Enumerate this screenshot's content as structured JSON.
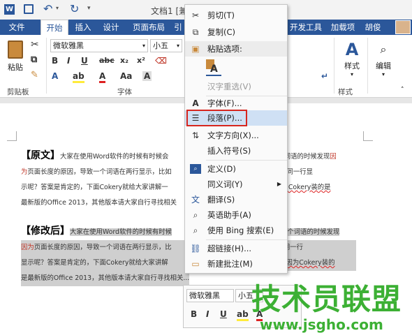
{
  "titlebar": {
    "title": "文档1 [兼容"
  },
  "tabs": [
    "文件",
    "开始",
    "插入",
    "设计",
    "页面布局",
    "引",
    "开发工具",
    "加载项",
    "胡俊"
  ],
  "ribbon": {
    "font_name": "微软雅黑",
    "font_size": "小五",
    "paste_label": "粘贴",
    "style_label": "样式",
    "edit_label": "编辑",
    "group_clipboard": "剪贴板",
    "group_font": "字体",
    "group_style": "样式"
  },
  "document": {
    "original_heading": "【原文】",
    "original_lines": [
      "大家在使用Word软件的时候有时候会",
      "个词语的时候发现",
      "因",
      "为",
      "页面长度的原因，导致一个词语在两行显示，比如",
      "法让词语在同一行显",
      "示呢？答案是肯定的，下面Cokery就给大家讲解一",
      "。因为Cokery装的是",
      "最新版的Office 2013，其他版本请大家自行寻找相关"
    ],
    "revised_heading": "【修改后】",
    "revised_lines": [
      "大家在使用Word软件的时候有时候",
      "一个词语的时候发现",
      "因为",
      "页面长度的原因，导致一个词语在两行显示，比",
      "办法让词语在同一行",
      "显示呢？答案是肯定的，下面Cokery就给大家讲解",
      "吧！因为Cokery装的",
      "是最新版的Office 2013，其他版本请大家自行寻找相关..."
    ]
  },
  "context_menu": {
    "items": [
      {
        "label": "剪切(T)",
        "icon": "scissors-icon",
        "disabled": false
      },
      {
        "label": "复制(C)",
        "icon": "copy-icon",
        "disabled": false
      },
      {
        "label": "粘贴选项:",
        "icon": "paste-icon",
        "disabled": false
      },
      {
        "label": "汉字重选(V)",
        "icon": "",
        "disabled": true
      },
      {
        "label": "字体(F)...",
        "icon": "font-icon",
        "disabled": false
      },
      {
        "label": "段落(P)...",
        "icon": "paragraph-icon",
        "disabled": false
      },
      {
        "label": "文字方向(X)...",
        "icon": "text-direction-icon",
        "disabled": false
      },
      {
        "label": "插入符号(S)",
        "icon": "",
        "disabled": false
      },
      {
        "label": "定义(D)",
        "icon": "define-icon",
        "disabled": false
      },
      {
        "label": "同义词(Y)",
        "icon": "",
        "disabled": false
      },
      {
        "label": "翻译(S)",
        "icon": "translate-icon",
        "disabled": false
      },
      {
        "label": "英语助手(A)",
        "icon": "english-assistant-icon",
        "disabled": false
      },
      {
        "label": "使用 Bing 搜索(E)",
        "icon": "search-icon",
        "disabled": false
      },
      {
        "label": "超链接(H)...",
        "icon": "hyperlink-icon",
        "disabled": false
      },
      {
        "label": "新建批注(M)",
        "icon": "comment-icon",
        "disabled": false
      }
    ],
    "paste_option_icon": "paste-text-only-icon"
  },
  "mini_toolbar": {
    "font_name": "微软雅黑",
    "font_size": "小五"
  },
  "watermark": {
    "title": "技术员联盟",
    "url": "www.jsgho.com"
  },
  "colors": {
    "accent": "#2b579a",
    "highlight_box": "#d7261e",
    "watermark": "#3cb034"
  }
}
